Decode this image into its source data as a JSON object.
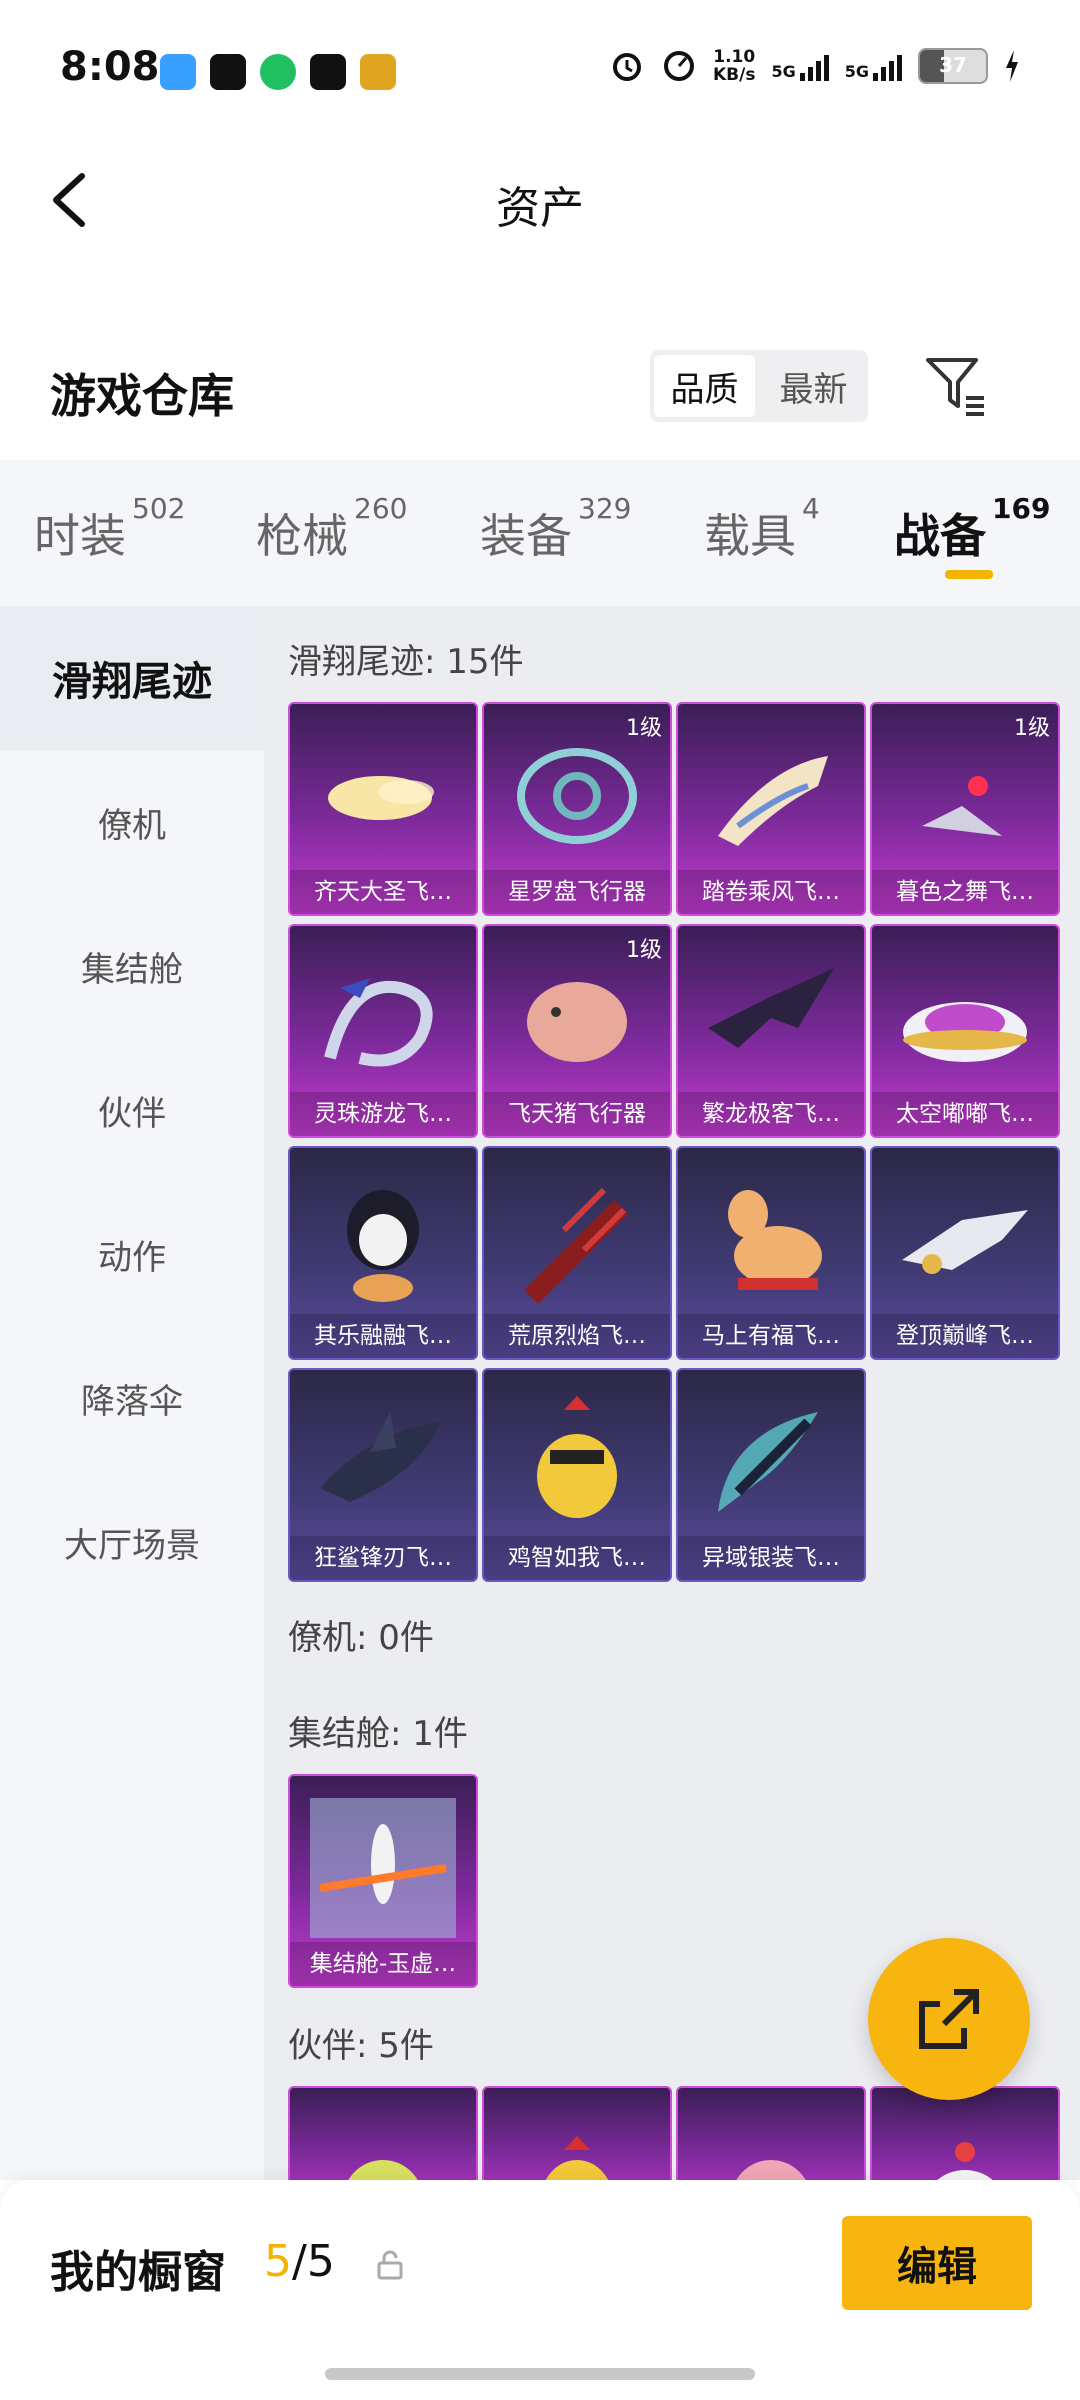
{
  "status": {
    "time": "8:08",
    "net_speed": "1.10",
    "net_unit": "KB/s",
    "sim1": "5G",
    "sim2": "5G",
    "battery": "37"
  },
  "header": {
    "title": "资产"
  },
  "section": {
    "title": "游戏仓库",
    "sort": [
      "品质",
      "最新"
    ]
  },
  "tabs": [
    {
      "label": "时装",
      "count": "502"
    },
    {
      "label": "枪械",
      "count": "260"
    },
    {
      "label": "装备",
      "count": "329"
    },
    {
      "label": "载具",
      "count": "4"
    },
    {
      "label": "战备",
      "count": "169"
    }
  ],
  "sidenav": [
    "滑翔尾迹",
    "僚机",
    "集结舱",
    "伙伴",
    "动作",
    "降落伞",
    "大厅场景"
  ],
  "groups": {
    "glide": {
      "title": "滑翔尾迹: 15件",
      "items": [
        {
          "name": "齐天大圣飞…",
          "level": ""
        },
        {
          "name": "星罗盘飞行器",
          "level": "1级"
        },
        {
          "name": "踏卷乘风飞…",
          "level": ""
        },
        {
          "name": "暮色之舞飞…",
          "level": "1级"
        },
        {
          "name": "灵珠游龙飞…",
          "level": ""
        },
        {
          "name": "飞天猪飞行器",
          "level": "1级"
        },
        {
          "name": "繁龙极客飞…",
          "level": ""
        },
        {
          "name": "太空嘟嘟飞…",
          "level": ""
        },
        {
          "name": "其乐融融飞…",
          "level": ""
        },
        {
          "name": "荒原烈焰飞…",
          "level": ""
        },
        {
          "name": "马上有福飞…",
          "level": ""
        },
        {
          "name": "登顶巅峰飞…",
          "level": ""
        },
        {
          "name": "狂鲨锋刃飞…",
          "level": ""
        },
        {
          "name": "鸡智如我飞…",
          "level": ""
        },
        {
          "name": "异域银装飞…",
          "level": ""
        }
      ]
    },
    "wingman": {
      "title": "僚机: 0件"
    },
    "capsule": {
      "title": "集结舱: 1件",
      "items": [
        {
          "name": "集结舱-玉虚…"
        }
      ]
    },
    "partner": {
      "title": "伙伴: 5件"
    }
  },
  "bottom": {
    "label": "我的橱窗",
    "current": "5",
    "total": "/5",
    "edit": "编辑"
  },
  "colors": {
    "accent": "#f8b40f",
    "purple_card": "#7d2a9b",
    "blue_card": "#413b75"
  }
}
